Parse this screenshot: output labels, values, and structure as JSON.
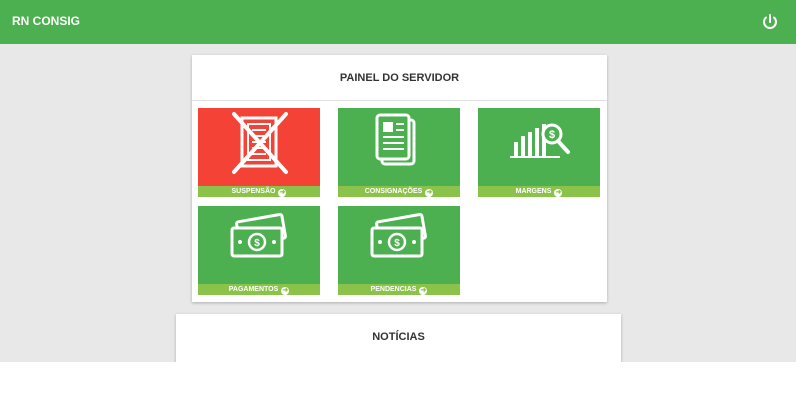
{
  "app": {
    "brand": "RN CONSIG"
  },
  "header": {
    "power_icon": "power-icon"
  },
  "panel": {
    "title": "PAINEL DO SERVIDOR",
    "tiles": [
      {
        "label": "SUSPENSÃO",
        "color": "#f44336",
        "icon": "suspended-document-icon"
      },
      {
        "label": "CONSIGNAÇÕES",
        "color": "#4caf50",
        "icon": "documents-icon"
      },
      {
        "label": "MARGENS",
        "color": "#4caf50",
        "icon": "chart-magnifier-icon"
      },
      {
        "label": "PAGAMENTOS",
        "color": "#4caf50",
        "icon": "money-bills-icon"
      },
      {
        "label": "PENDENCIAS",
        "color": "#4caf50",
        "icon": "money-bills-icon"
      }
    ]
  },
  "news": {
    "title": "NOTÍCIAS"
  },
  "colors": {
    "topbar": "#4caf50",
    "tile_footer": "#8bc34a",
    "background": "#e8e8e8"
  }
}
